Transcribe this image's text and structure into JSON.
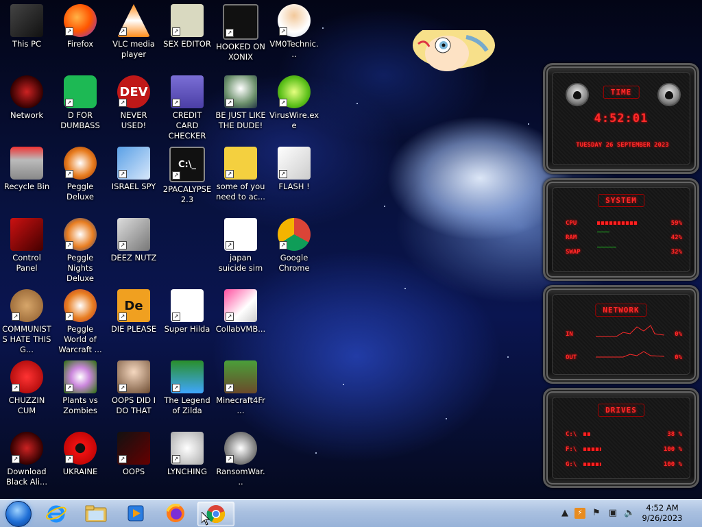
{
  "desktop": {
    "icons": [
      {
        "label": "This PC"
      },
      {
        "label": "Firefox"
      },
      {
        "label": "VLC media player"
      },
      {
        "label": "SEX EDITOR"
      },
      {
        "label": "HOOKED ON XONIX"
      },
      {
        "label": "VM0Technic..."
      },
      {
        "label": "Network"
      },
      {
        "label": "D FOR DUMBASS"
      },
      {
        "label": "NEVER USED!"
      },
      {
        "label": "CREDIT CARD CHECKER"
      },
      {
        "label": "BE JUST LIKE THE DUDE!"
      },
      {
        "label": "VirusWire.exe"
      },
      {
        "label": "Recycle Bin"
      },
      {
        "label": "Peggle Deluxe"
      },
      {
        "label": "ISRAEL SPY"
      },
      {
        "label": "2PACALYPSE 2.3"
      },
      {
        "label": "some of you need to ac..."
      },
      {
        "label": "FLASH !"
      },
      {
        "label": "Control Panel"
      },
      {
        "label": "Peggle Nights Deluxe"
      },
      {
        "label": "DEEZ NUTZ"
      },
      {
        "label": "japan suicide sim"
      },
      {
        "label": "Google Chrome"
      },
      {
        "label": "COMMUNISTS HATE THIS G..."
      },
      {
        "label": "Peggle World of Warcraft ..."
      },
      {
        "label": "DIE PLEASE"
      },
      {
        "label": "Super Hilda"
      },
      {
        "label": "CollabVMB..."
      },
      {
        "label": "CHUZZIN CUM"
      },
      {
        "label": "Plants vs Zombies"
      },
      {
        "label": "OOPS DID I DO THAT"
      },
      {
        "label": "The Legend of Zilda"
      },
      {
        "label": "Minecraft4Fr..."
      },
      {
        "label": "Download Black Ali..."
      },
      {
        "label": "UKRAINE"
      },
      {
        "label": "OOPS"
      },
      {
        "label": "LYNCHING"
      },
      {
        "label": "RansomWar..."
      }
    ],
    "icon_texts": {
      "dev": "DEV",
      "dev_sub": "C++",
      "de": "De",
      "cmd": "C:\\_"
    }
  },
  "gadget": {
    "time_panel": {
      "title": "TIME",
      "time": "4:52:01",
      "date": "TUESDAY 26 SEPTEMBER 2023"
    },
    "system_panel": {
      "title": "SYSTEM",
      "rows": [
        {
          "label": "CPU",
          "value": "59%",
          "level": 0.59
        },
        {
          "label": "RAM",
          "value": "42%",
          "level": 0.42
        },
        {
          "label": "SWAP",
          "value": "32%",
          "level": 0.32
        }
      ]
    },
    "network_panel": {
      "title": "NETWORK",
      "rows": [
        {
          "label": "IN",
          "value": "0%"
        },
        {
          "label": "OUT",
          "value": "0%"
        }
      ]
    },
    "drives_panel": {
      "title": "DRIVES",
      "rows": [
        {
          "label": "C:\\",
          "value": "38 %",
          "level": 0.38
        },
        {
          "label": "F:\\",
          "value": "100 %",
          "level": 1.0
        },
        {
          "label": "G:\\",
          "value": "100 %",
          "level": 1.0
        }
      ]
    }
  },
  "taskbar": {
    "pinned": [
      "start-orb",
      "internet-explorer",
      "file-explorer",
      "media-player",
      "firefox",
      "chrome"
    ],
    "active": "chrome",
    "clock": {
      "time": "4:52 AM",
      "date": "9/26/2023"
    }
  },
  "colors": {
    "gadget_red": "#ff2a2a",
    "taskbar": "#a9c0e0"
  }
}
